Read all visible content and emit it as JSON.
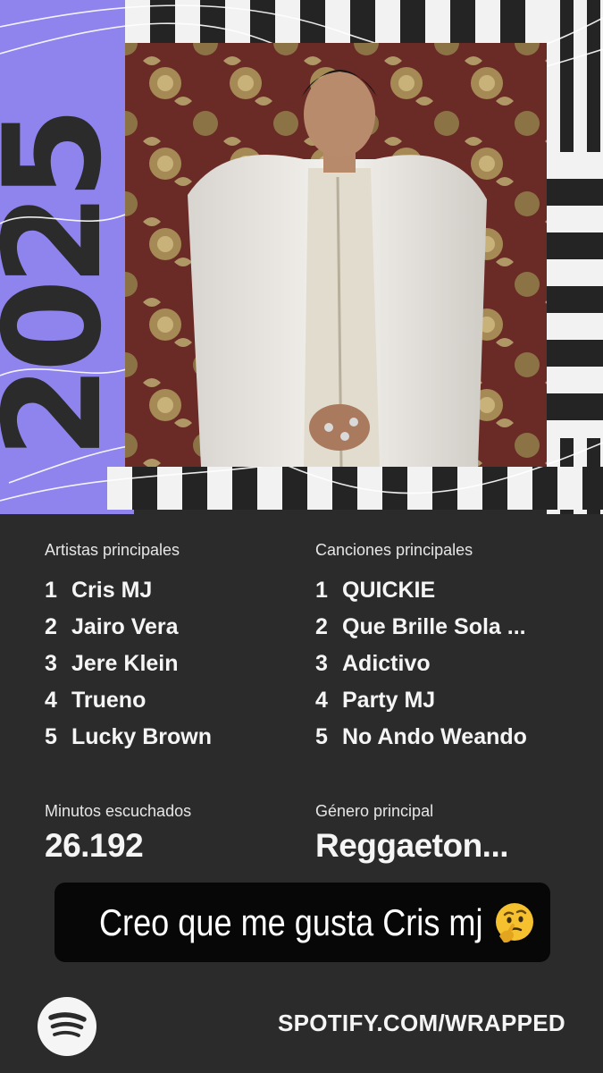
{
  "card": {
    "year": "2025"
  },
  "top_artists": {
    "title": "Artistas principales",
    "items": [
      {
        "rank": "1",
        "name": "Cris MJ"
      },
      {
        "rank": "2",
        "name": "Jairo Vera"
      },
      {
        "rank": "3",
        "name": "Jere Klein"
      },
      {
        "rank": "4",
        "name": "Trueno"
      },
      {
        "rank": "5",
        "name": "Lucky Brown"
      }
    ]
  },
  "top_songs": {
    "title": "Canciones principales",
    "items": [
      {
        "rank": "1",
        "name": "QUICKIE"
      },
      {
        "rank": "2",
        "name": "Que Brille Sola ..."
      },
      {
        "rank": "3",
        "name": "Adictivo"
      },
      {
        "rank": "4",
        "name": "Party MJ"
      },
      {
        "rank": "5",
        "name": "No Ando Weando"
      }
    ]
  },
  "minutes": {
    "label": "Minutos escuchados",
    "value": "26.192"
  },
  "genre": {
    "label": "Género principal",
    "value": "Reggaeton..."
  },
  "caption": {
    "text": "Creo que me gusta Cris mj",
    "emoji_icon": "thinking-face-icon"
  },
  "footer": {
    "url": "SPOTIFY.COM/WRAPPED",
    "logo_icon": "spotify-logo-icon"
  },
  "colors": {
    "background": "#2b2b2b",
    "accent_purple": "#8f84ee"
  }
}
